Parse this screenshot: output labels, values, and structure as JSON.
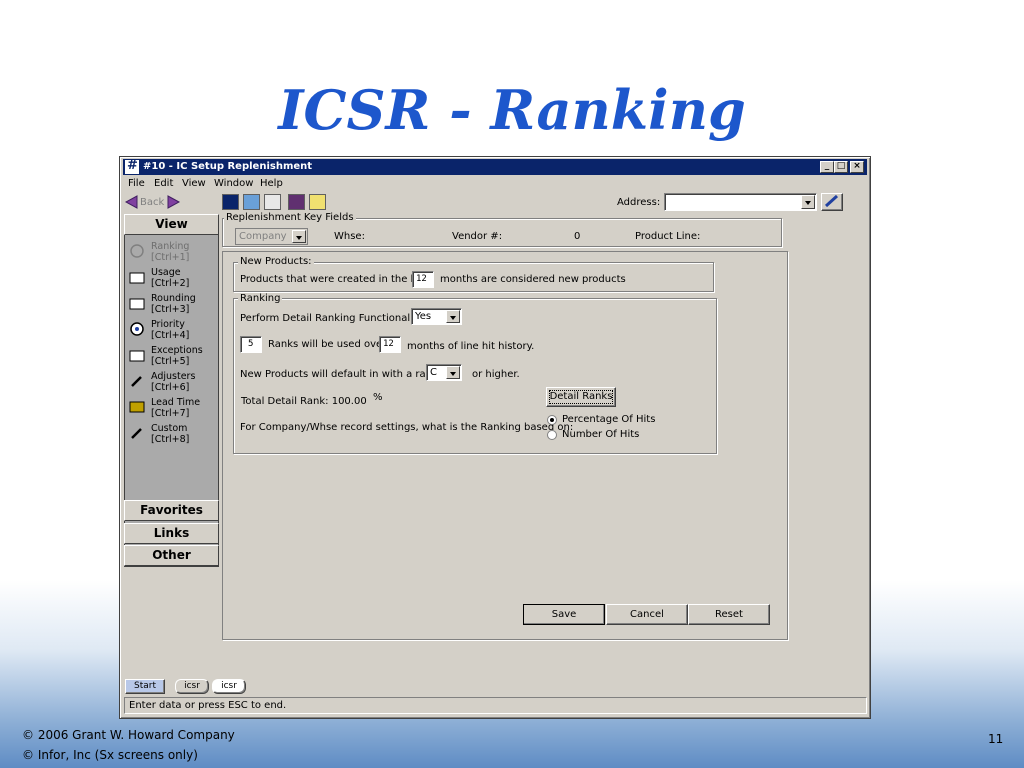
{
  "slide": {
    "title": "ICSR - Ranking",
    "footer_line1": "©  2006 Grant W. Howard Company",
    "footer_line2": "©  Infor, Inc (Sx screens only)",
    "page_number": "11"
  },
  "window": {
    "title": "#10 - IC Setup Replenishment",
    "min": "_",
    "max": "□",
    "close": "×"
  },
  "menu": [
    "File",
    "Edit",
    "View",
    "Window",
    "Help"
  ],
  "toolbar": {
    "back_label": "Back",
    "address_label": "Address:",
    "address_value": ""
  },
  "nav": {
    "view_header": "View",
    "items": [
      {
        "label": "Ranking",
        "shortcut": "[Ctrl+1]"
      },
      {
        "label": "Usage",
        "shortcut": "[Ctrl+2]"
      },
      {
        "label": "Rounding",
        "shortcut": "[Ctrl+3]"
      },
      {
        "label": "Priority",
        "shortcut": "[Ctrl+4]"
      },
      {
        "label": "Exceptions",
        "shortcut": "[Ctrl+5]"
      },
      {
        "label": "Adjusters",
        "shortcut": "[Ctrl+6]"
      },
      {
        "label": "Lead Time",
        "shortcut": "[Ctrl+7]"
      },
      {
        "label": "Custom",
        "shortcut": "[Ctrl+8]"
      }
    ],
    "favorites": "Favorites",
    "links": "Links",
    "other": "Other"
  },
  "keyfields": {
    "legend": "Replenishment Key Fields",
    "company_value": "Company",
    "whse_label": "Whse:",
    "vendor_label": "Vendor #:",
    "vendor_value": "0",
    "product_line_label": "Product Line:"
  },
  "new_products": {
    "legend": "New Products:",
    "prefix": "Products that were created in the last",
    "months_value": "12",
    "suffix": "months are considered new products"
  },
  "ranking": {
    "legend": "Ranking",
    "detail_label": "Perform Detail Ranking Functionality?",
    "detail_value": "Yes",
    "ranks_value": "5",
    "ranks_mid": "Ranks will be used over",
    "months_value": "12",
    "ranks_suffix": "months of line hit history.",
    "default_label": "New Products will default in with a rank of",
    "default_value": "C",
    "default_suffix": "or higher.",
    "detail_ranks_button": "Detail Ranks",
    "total_label": "Total Detail Rank: 100.00",
    "percent_sign": "%",
    "based_on_label": "For Company/Whse record settings, what is the Ranking based on:",
    "option_pct": "Percentage Of Hits",
    "option_num": "Number Of Hits"
  },
  "actions": {
    "save": "Save",
    "cancel": "Cancel",
    "reset": "Reset"
  },
  "taskbar": {
    "start": "Start",
    "tab1": "icsr",
    "tab2": "icsr"
  },
  "status": "Enter data or press ESC to end."
}
